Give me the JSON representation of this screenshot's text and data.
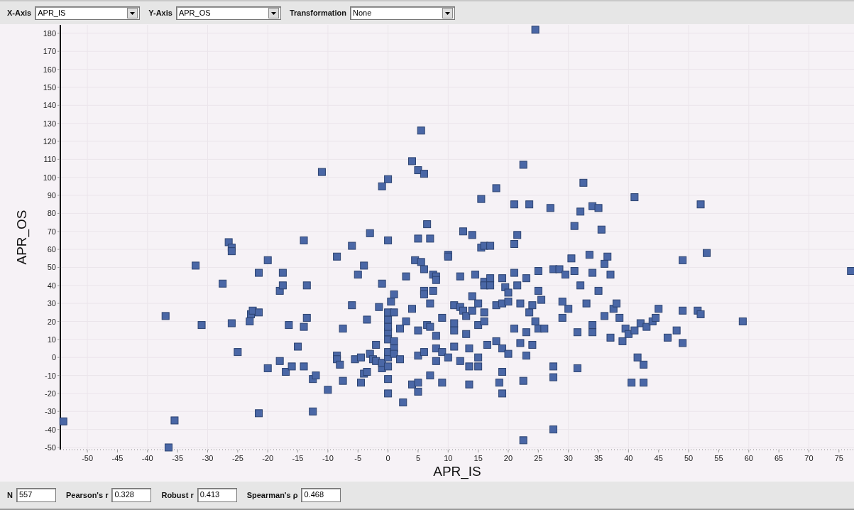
{
  "toolbar": [
    {
      "label": "X-Axis",
      "value": "APR_IS"
    },
    {
      "label": "Y-Axis",
      "value": "APR_OS"
    },
    {
      "label": "Transformation",
      "value": "None"
    }
  ],
  "chart": {
    "chart_data": {
      "type": "scatter",
      "grid": true,
      "xlabel": "APR_IS",
      "ylabel": "APR_OS",
      "xlim": [
        -54.5,
        77.5
      ],
      "ylim": [
        -51.2,
        184.7
      ],
      "xticks": [
        -50,
        -45,
        -40,
        -35,
        -30,
        -25,
        -20,
        -15,
        -10,
        -5,
        0,
        5,
        10,
        15,
        20,
        25,
        30,
        35,
        40,
        45,
        50,
        55,
        60,
        65,
        70,
        75
      ],
      "yticks": [
        -50,
        -40,
        -30,
        -20,
        -10,
        0,
        10,
        20,
        30,
        40,
        50,
        60,
        70,
        80,
        90,
        100,
        110,
        120,
        130,
        140,
        150,
        160,
        170,
        180
      ],
      "x": [
        -54,
        -36.5,
        -35.5,
        -37,
        -31,
        -32,
        -27.5,
        -26.5,
        -26,
        -26,
        -26,
        -25,
        -23,
        -22.8,
        -22.5,
        -21.5,
        -21.5,
        -21.5,
        -20,
        -20,
        -18,
        -18,
        -17.5,
        -17.5,
        -17,
        -16.5,
        -16,
        -15,
        -14,
        -14,
        -13.5,
        -13.5,
        -14,
        -12.5,
        -12.5,
        -12,
        -11,
        -10,
        -8.5,
        -8.5,
        -8.5,
        -8,
        -7.5,
        -7.5,
        -6,
        -6,
        -5.5,
        -5,
        -4.5,
        -4.5,
        -4,
        -4,
        -3.5,
        -3.5,
        -3,
        -3,
        -2.5,
        -2,
        -2,
        -1.5,
        -1,
        -1,
        -1,
        -1,
        0,
        0,
        0,
        0,
        0,
        0,
        0,
        0,
        0,
        0,
        0,
        0,
        0.5,
        1,
        1,
        1,
        1,
        1,
        2,
        2,
        2.5,
        3,
        3,
        4,
        4,
        4.5,
        4,
        5,
        5,
        5,
        5,
        5,
        5,
        5.5,
        5.5,
        6,
        6,
        6,
        6,
        6.5,
        6.5,
        6,
        7,
        7,
        7,
        7,
        7.5,
        7.5,
        8,
        8,
        8,
        8,
        8,
        9,
        9,
        9,
        10,
        10,
        10,
        11,
        11,
        11,
        11,
        12,
        12,
        12,
        12.5,
        12.5,
        13,
        13,
        13.5,
        13.5,
        13.5,
        14,
        14,
        14,
        14.5,
        15,
        15,
        15,
        15,
        15.5,
        15.5,
        16,
        16,
        16,
        16,
        16,
        16.5,
        17,
        17,
        17,
        18,
        18,
        18,
        18.5,
        19,
        19,
        19,
        19,
        19,
        19.5,
        20,
        20,
        20,
        21,
        21,
        21,
        21,
        21.5,
        21.5,
        22,
        22,
        22.5,
        22.5,
        22.5,
        23,
        23,
        23,
        23.5,
        23.5,
        24,
        24,
        24.5,
        24.5,
        25,
        25,
        25,
        25.5,
        26,
        27,
        27.5,
        27.5,
        27.5,
        27.5,
        28.5,
        29,
        29,
        29.5,
        30,
        30.5,
        31,
        31,
        31.5,
        31.5,
        32,
        32,
        32.5,
        33,
        33.5,
        34,
        34,
        34,
        34,
        35,
        35,
        35.5,
        36,
        36,
        36.5,
        37,
        37,
        37.5,
        38,
        38.5,
        39,
        39.5,
        40,
        40.5,
        41,
        41,
        41.5,
        42,
        42.5,
        42.5,
        43,
        44,
        44.5,
        45,
        46.5,
        48,
        49,
        49,
        49,
        51.5,
        52,
        52,
        53,
        59,
        77
      ],
      "series": [
        {
          "color": "#4a67a6",
          "values": [
            -35.5,
            -50,
            -35,
            23,
            18,
            51,
            41,
            64,
            61,
            59,
            19,
            3,
            20,
            24,
            26,
            25,
            47,
            -31,
            54,
            -6,
            -2,
            37,
            40,
            47,
            -8,
            18,
            -5,
            6,
            65,
            17,
            22,
            40,
            -5,
            -30,
            -12,
            -10,
            103,
            -18,
            56,
            1,
            -1,
            -4,
            16,
            -13,
            29,
            62,
            -1,
            46,
            -14,
            0,
            51,
            -9,
            -8,
            21,
            2,
            69,
            -1,
            -2,
            7,
            28,
            41,
            -6,
            -3,
            95,
            99,
            65,
            -20,
            -12,
            -5,
            0,
            3,
            10,
            14,
            17,
            21,
            25,
            31,
            35,
            25,
            9,
            5,
            2,
            -1,
            16,
            -25,
            20,
            45,
            109,
            27,
            54,
            -15,
            66,
            -19,
            -14,
            1,
            15,
            104,
            126,
            53,
            49,
            37,
            35,
            102,
            74,
            18,
            3,
            66,
            30,
            17,
            -10,
            37,
            46,
            45,
            43,
            12,
            5,
            -2,
            22,
            -14,
            3,
            57,
            56,
            0,
            29,
            6,
            15,
            19,
            -2,
            28,
            45,
            26,
            70,
            23,
            13,
            -15,
            -5,
            5,
            68,
            34,
            26,
            46,
            0,
            -5,
            18,
            30,
            88,
            61,
            62,
            42,
            40,
            25,
            20,
            7,
            62,
            44,
            40,
            94,
            29,
            9,
            -14,
            -8,
            -20,
            5,
            30,
            44,
            39,
            36,
            31,
            2,
            63,
            16,
            47,
            85,
            68,
            40,
            30,
            8,
            -13,
            -46,
            107,
            44,
            14,
            1,
            85,
            25,
            29,
            7,
            182,
            20,
            48,
            16,
            37,
            32,
            16,
            83,
            -5,
            -11,
            -40,
            49,
            49,
            31,
            22,
            46,
            27,
            55,
            73,
            48,
            14,
            -6,
            81,
            40,
            97,
            30,
            57,
            84,
            47,
            18,
            14,
            37,
            83,
            71,
            52,
            23,
            56,
            46,
            11,
            27,
            30,
            22,
            9,
            16,
            13,
            -14,
            15,
            89,
            0,
            19,
            -14,
            -4,
            17,
            20,
            22,
            27,
            11,
            15,
            8,
            26,
            54,
            26,
            24,
            85,
            58,
            20,
            48
          ]
        }
      ]
    }
  },
  "stats": [
    {
      "label": "N",
      "value": "557"
    },
    {
      "label": "Pearson's r",
      "value": "0.328"
    },
    {
      "label": "Robust r",
      "value": "0.413"
    },
    {
      "label": "Spearman's ρ",
      "value": "0.468"
    }
  ]
}
